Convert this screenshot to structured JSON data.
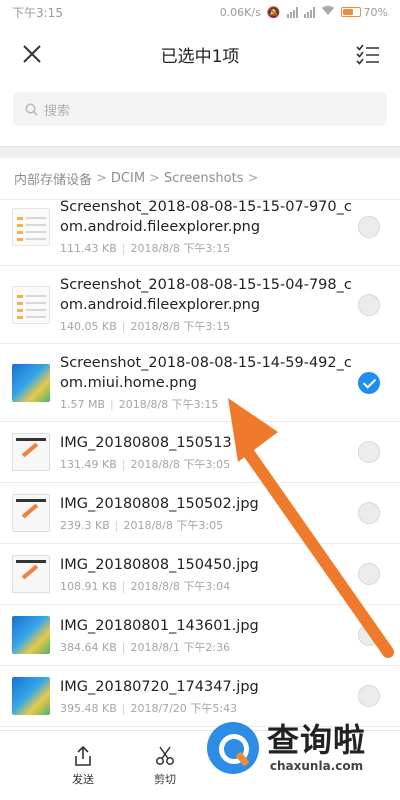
{
  "status_bar": {
    "time": "下午3:15",
    "speed": "0.06K/s",
    "battery": "70%",
    "battery_level": 0.7
  },
  "header": {
    "title": "已选中1项"
  },
  "search": {
    "placeholder": "搜索"
  },
  "breadcrumb": [
    "内部存储设备",
    "DCIM",
    "Screenshots"
  ],
  "files": [
    {
      "name": "Screenshot_2018-08-08-15-15-07-970_com.android.fileexplorer.png",
      "size": "111.43 KB",
      "date": "2018/8/8 下午3:15",
      "thumb": "doc",
      "checked": false
    },
    {
      "name": "Screenshot_2018-08-08-15-15-04-798_com.android.fileexplorer.png",
      "size": "140.05 KB",
      "date": "2018/8/8 下午3:15",
      "thumb": "doc",
      "checked": false
    },
    {
      "name": "Screenshot_2018-08-08-15-14-59-492_com.miui.home.png",
      "size": "1.57 MB",
      "date": "2018/8/8 下午3:15",
      "thumb": "blue",
      "checked": true
    },
    {
      "name": "IMG_20180808_150513",
      "size": "131.49 KB",
      "date": "2018/8/8 下午3:05",
      "thumb": "screen",
      "checked": false
    },
    {
      "name": "IMG_20180808_150502.jpg",
      "size": "239.3 KB",
      "date": "2018/8/8 下午3:05",
      "thumb": "screen",
      "checked": false
    },
    {
      "name": "IMG_20180808_150450.jpg",
      "size": "108.91 KB",
      "date": "2018/8/8 下午3:04",
      "thumb": "screen",
      "checked": false
    },
    {
      "name": "IMG_20180801_143601.jpg",
      "size": "384.64 KB",
      "date": "2018/8/1 下午2:36",
      "thumb": "blue",
      "checked": false
    },
    {
      "name": "IMG_20180720_174347.jpg",
      "size": "395.48 KB",
      "date": "2018/7/20 下午5:43",
      "thumb": "blue",
      "checked": false
    }
  ],
  "actions": [
    {
      "label": "发送",
      "icon": "share-icon"
    },
    {
      "label": "剪切",
      "icon": "scissors-icon"
    }
  ],
  "watermark": {
    "main": "查询啦",
    "sub": "chaxunla.com"
  },
  "colors": {
    "accent": "#1d8ef2",
    "arrow": "#f07a2c"
  }
}
